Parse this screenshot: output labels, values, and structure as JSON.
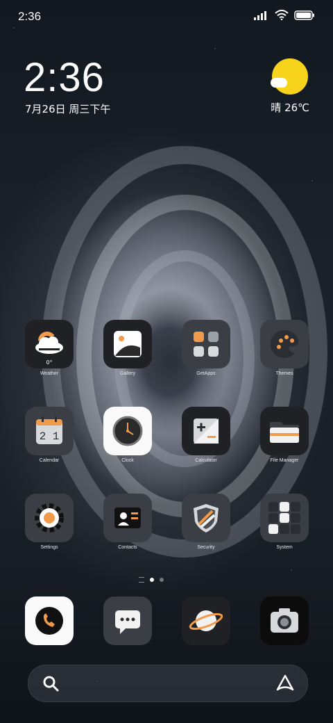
{
  "status": {
    "time": "2:36"
  },
  "clock_widget": {
    "time": "2:36",
    "date": "7月26日 周三下午"
  },
  "weather_widget": {
    "text": "晴 26℃"
  },
  "apps": [
    {
      "label": "Weather",
      "badge": "0°"
    },
    {
      "label": "Gallery"
    },
    {
      "label": "GetApps"
    },
    {
      "label": "Themes"
    },
    {
      "label": "Calendar",
      "digits": "2 1"
    },
    {
      "label": "Clock"
    },
    {
      "label": "Calculator"
    },
    {
      "label": "File Manager"
    },
    {
      "label": "Settings"
    },
    {
      "label": "Contacts"
    },
    {
      "label": "Security"
    },
    {
      "label": "System"
    }
  ],
  "dock": [
    "Phone",
    "Messages",
    "Browser",
    "Camera"
  ],
  "colors": {
    "accent": "#f29a4b",
    "sun": "#f7d31b"
  }
}
